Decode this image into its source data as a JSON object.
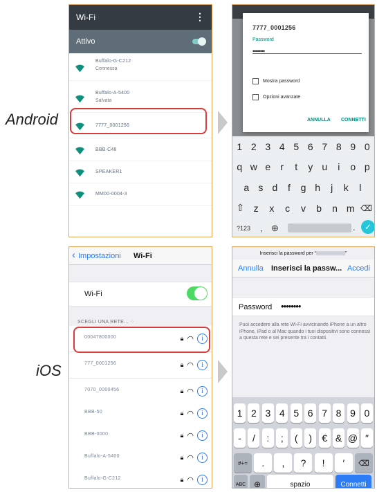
{
  "labels": {
    "android": "Android",
    "ios": "iOS"
  },
  "android_wifi": {
    "title": "Wi-Fi",
    "toggle_label": "Attivo",
    "networks": [
      {
        "name": "Buffalo-G-C212",
        "status": "Connessa"
      },
      {
        "name": "Buffalo-A-5400",
        "status": "Salvata"
      },
      {
        "name": "7777_0001256",
        "status": ""
      },
      {
        "name": "BBB-C48",
        "status": ""
      },
      {
        "name": "SPEAKER1",
        "status": ""
      },
      {
        "name": "MM00-0004-3",
        "status": ""
      }
    ]
  },
  "android_dialog": {
    "network": "7777_0001256",
    "password_label": "Password",
    "password_value": "••••••••",
    "show_password": "Mostra password",
    "advanced": "Opzioni avanzate",
    "cancel": "ANNULLA",
    "connect": "CONNETTI"
  },
  "android_keyboard": {
    "row1": [
      "1",
      "2",
      "3",
      "4",
      "5",
      "6",
      "7",
      "8",
      "9",
      "0"
    ],
    "row2": [
      "q",
      "w",
      "e",
      "r",
      "t",
      "y",
      "u",
      "i",
      "o",
      "p"
    ],
    "row3": [
      "a",
      "s",
      "d",
      "f",
      "g",
      "h",
      "j",
      "k",
      "l"
    ],
    "row4": [
      "z",
      "x",
      "c",
      "v",
      "b",
      "n",
      "m"
    ],
    "sym": "?123",
    "comma": ",",
    "period": "."
  },
  "ios_wifi": {
    "back": "Impostazioni",
    "title": "Wi-Fi",
    "wifi_label": "Wi-Fi",
    "section": "SCEGLI UNA RETE...",
    "networks": [
      "00047800000",
      "777_0001256",
      "7070_0000456",
      "BBB-50",
      "BBB-0000",
      "Buffalo-A-5400",
      "Buffalo-G-C212"
    ]
  },
  "ios_password": {
    "prompt": "Inserisci la password per “",
    "prompt_end": "”",
    "cancel": "Annulla",
    "title": "Inserisci la passw...",
    "join": "Accedi",
    "password_label": "Password",
    "password_value": "••••••••",
    "note": "Puoi accedere alla rete Wi-Fi avvicinando iPhone a un altro iPhone, iPad o al Mac quando i tuoi dispositivi sono connessi a questa rete e sei presente tra i contatti."
  },
  "ios_keyboard": {
    "row1": [
      "1",
      "2",
      "3",
      "4",
      "5",
      "6",
      "7",
      "8",
      "9",
      "0"
    ],
    "row2": [
      "-",
      "/",
      ":",
      ";",
      "(",
      ")",
      "€",
      "&",
      "@",
      "″"
    ],
    "row3": [
      ".",
      ",",
      "?",
      "!",
      "′"
    ],
    "sym": "#+=",
    "abc": "ABC",
    "space": "spazio",
    "connect": "Connetti"
  }
}
